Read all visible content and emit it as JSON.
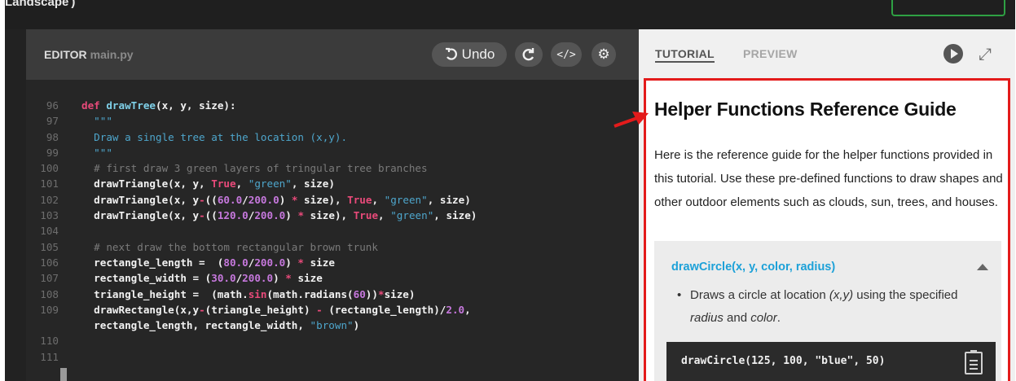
{
  "app": {
    "title": "Landscape )"
  },
  "editor": {
    "label": "EDITOR",
    "filename": "main.py",
    "toolbar": {
      "undo_label": "Undo",
      "redo_icon": "redo-icon",
      "code_icon": "code-icon",
      "settings_icon": "gear-icon"
    },
    "line_numbers": [
      "96",
      "97",
      "98",
      "99",
      "100",
      "101",
      "102",
      "103",
      "104",
      "105",
      "106",
      "107",
      "108",
      "109",
      "",
      "110",
      "111"
    ],
    "lines": [
      "def drawTree(x, y, size):",
      "  \"\"\"",
      "  Draw a single tree at the location (x,y).",
      "  \"\"\"",
      "  # first draw 3 green layers of tringular tree branches",
      "  drawTriangle(x, y, True, \"green\", size)",
      "  drawTriangle(x, y-((60.0/200.0) * size), True, \"green\", size)",
      "  drawTriangle(x, y-((120.0/200.0) * size), True, \"green\", size)",
      "",
      "  # next draw the bottom rectangular brown trunk",
      "  rectangle_length =  (80.0/200.0) * size",
      "  rectangle_width = (30.0/200.0) * size",
      "  triangle_height =  (math.sin(math.radians(60))*size)",
      "  drawRectangle(x,y-(triangle_height) - (rectangle_length)/2.0,",
      "  rectangle_length, rectangle_width, \"brown\")",
      "",
      ""
    ]
  },
  "tutorial": {
    "tabs": [
      "TUTORIAL",
      "PREVIEW"
    ],
    "active_tab": "TUTORIAL",
    "guide_title": "Helper Functions Reference Guide",
    "intro": "Here is the reference guide for the helper functions provided in this tutorial. Use these pre-defined functions to draw shapes and other outdoor elements such as clouds, sun, trees, and houses.",
    "function": {
      "signature": "drawCircle(x, y, color, radius)",
      "description_parts": [
        "Draws a circle at location ",
        "(x,y)",
        " using the specified ",
        "radius",
        " and ",
        "color",
        "."
      ],
      "example": "drawCircle(125, 100, \"blue\", 50)",
      "copy_icon": "clipboard-icon"
    }
  },
  "colors": {
    "highlight_box": "#e31b1b",
    "signature": "#1da1d8",
    "keyword": "#e94a7a",
    "string": "#4ea6cc",
    "number": "#c678dd"
  }
}
